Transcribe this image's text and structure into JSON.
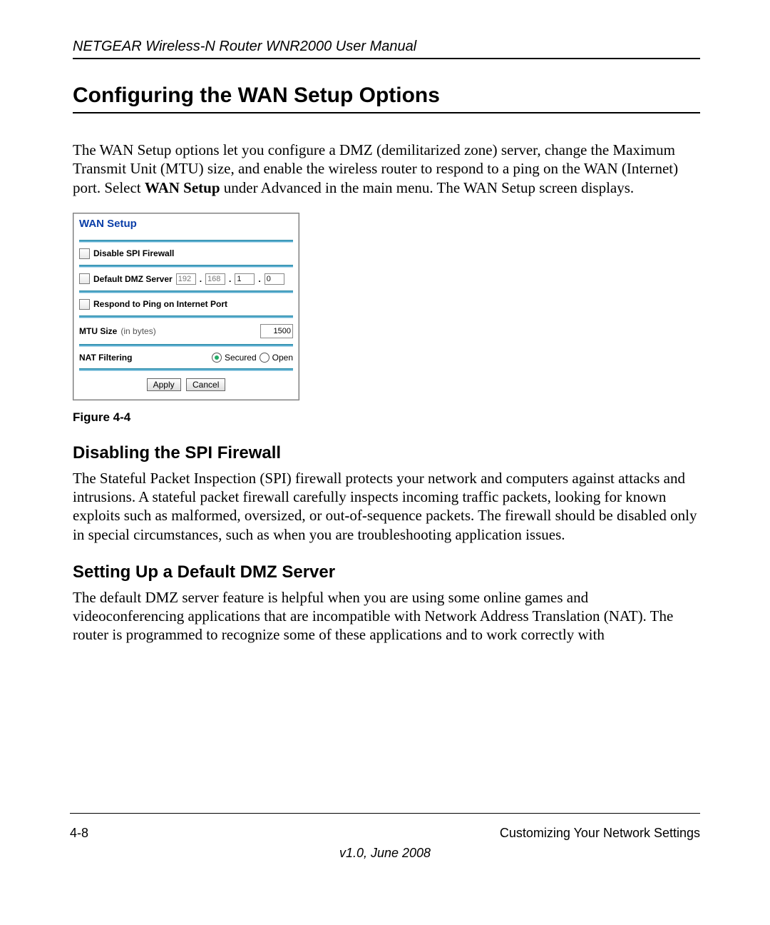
{
  "header": {
    "running": "NETGEAR Wireless-N Router WNR2000 User Manual"
  },
  "title": "Configuring the WAN Setup Options",
  "intro": {
    "pre": "The WAN Setup options let you configure a DMZ (demilitarized zone) server, change the Maximum Transmit Unit (MTU) size, and enable the wireless router to respond to a ping on the WAN (Internet) port. Select ",
    "bold": "WAN Setup",
    "post": " under Advanced in the main menu. The WAN Setup screen displays."
  },
  "screenshot": {
    "title": "WAN Setup",
    "rows": {
      "spi": "Disable SPI Firewall",
      "dmz": "Default DMZ Server",
      "dmz_ip": [
        "192",
        "168",
        "1",
        "0"
      ],
      "ping": "Respond to Ping on Internet Port",
      "mtu_label": "MTU Size",
      "mtu_sub": "(in bytes)",
      "mtu_value": "1500",
      "nat_label": "NAT Filtering",
      "nat_opts": [
        "Secured",
        "Open"
      ]
    },
    "buttons": {
      "apply": "Apply",
      "cancel": "Cancel"
    }
  },
  "figcap": "Figure 4-4",
  "sub1": {
    "title": "Disabling the SPI Firewall",
    "body": "The Stateful Packet Inspection (SPI) firewall protects your network and computers against attacks and intrusions. A stateful packet firewall carefully inspects incoming traffic packets, looking for known exploits such as malformed, oversized, or out-of-sequence packets. The firewall should be disabled only in special circumstances, such as when you are troubleshooting application issues."
  },
  "sub2": {
    "title": "Setting Up a Default DMZ Server",
    "body": "The default DMZ server feature is helpful when you are using some online games and videoconferencing applications that are incompatible with Network Address Translation (NAT). The router is programmed to recognize some of these applications and to work correctly with"
  },
  "footer": {
    "pagenum": "4-8",
    "section": "Customizing Your Network Settings",
    "version": "v1.0, June 2008"
  }
}
